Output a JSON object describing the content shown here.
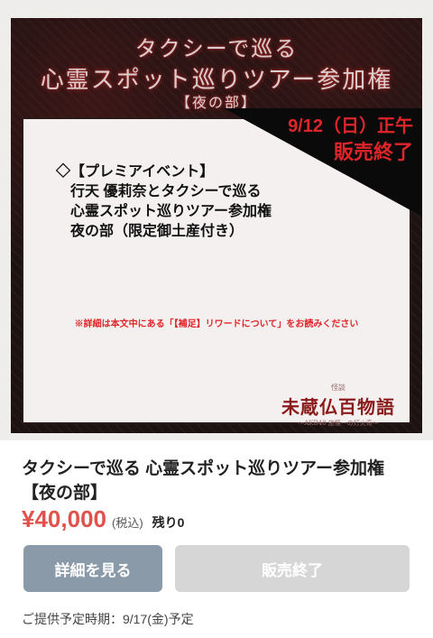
{
  "banner": {
    "title_line1": "タクシーで巡る",
    "title_line2": "心霊スポット巡りツアー参加権",
    "title_line3": "【夜の部】",
    "sale_date": "9/12（日）正午",
    "sale_end": "販売終了",
    "event_lines": [
      "◇【プレミアイベント】",
      "行天 優莉奈とタクシーで巡る",
      "心霊スポット巡りツアー参加権",
      "夜の部（限定御土産付き）"
    ],
    "notice": "※詳細は本文中にある「【補足】リワードについて」をお読みください",
    "brand_sub": "怪談",
    "brand_main": "未蔵仏百物語",
    "brand_tag": "〜AKB48 旅懐一の灯火奇〜"
  },
  "product": {
    "title": "タクシーで巡る 心霊スポット巡りツアー参加権 【夜の部】",
    "price": "¥40,000",
    "tax_note": "(税込)",
    "remaining": "残り0"
  },
  "actions": {
    "detail_label": "詳細を見る",
    "soldout_label": "販売終了"
  },
  "delivery": {
    "text": "ご提供予定時期：9/17(金)予定"
  },
  "colors": {
    "price": "#e0524b",
    "sale_red": "#e0252a",
    "detail_button": "#8a9aa8",
    "disabled_button": "#d6d6d6"
  }
}
